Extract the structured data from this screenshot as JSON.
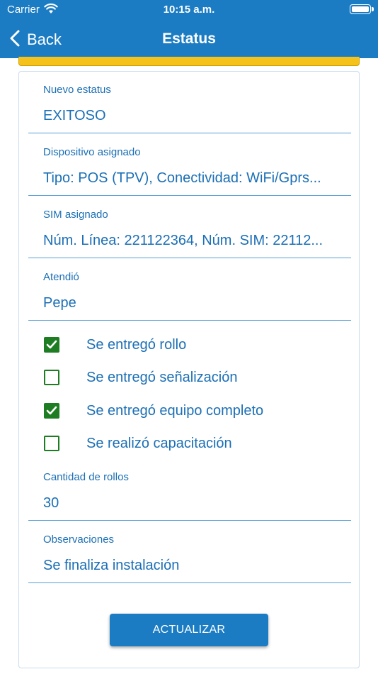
{
  "status_bar": {
    "carrier": "Carrier",
    "time": "10:15 a.m."
  },
  "nav": {
    "back_label": "Back",
    "title": "Estatus"
  },
  "fields": [
    {
      "label": "Nuevo estatus",
      "value": "EXITOSO"
    },
    {
      "label": "Dispositivo asignado",
      "value": "Tipo: POS (TPV), Conectividad: WiFi/Gprs..."
    },
    {
      "label": "SIM asignado",
      "value": "Núm. Línea: 221122364, Núm. SIM: 22112..."
    },
    {
      "label": "Atendió",
      "value": "Pepe"
    }
  ],
  "checkboxes": [
    {
      "label": "Se entregó rollo",
      "checked": true
    },
    {
      "label": "Se entregó señalización",
      "checked": false
    },
    {
      "label": "Se entregó equipo completo",
      "checked": true
    },
    {
      "label": "Se realizó capacitación",
      "checked": false
    }
  ],
  "rollos": {
    "label": "Cantidad de rollos",
    "value": "30"
  },
  "observaciones": {
    "label": "Observaciones",
    "value": "Se finaliza instalación"
  },
  "button": {
    "label": "ACTUALIZAR"
  },
  "colors": {
    "primary": "#1b7cc3",
    "text_blue": "#1b6fb5",
    "check_green": "#1e7d22",
    "warning_yellow": "#f5c21b"
  }
}
